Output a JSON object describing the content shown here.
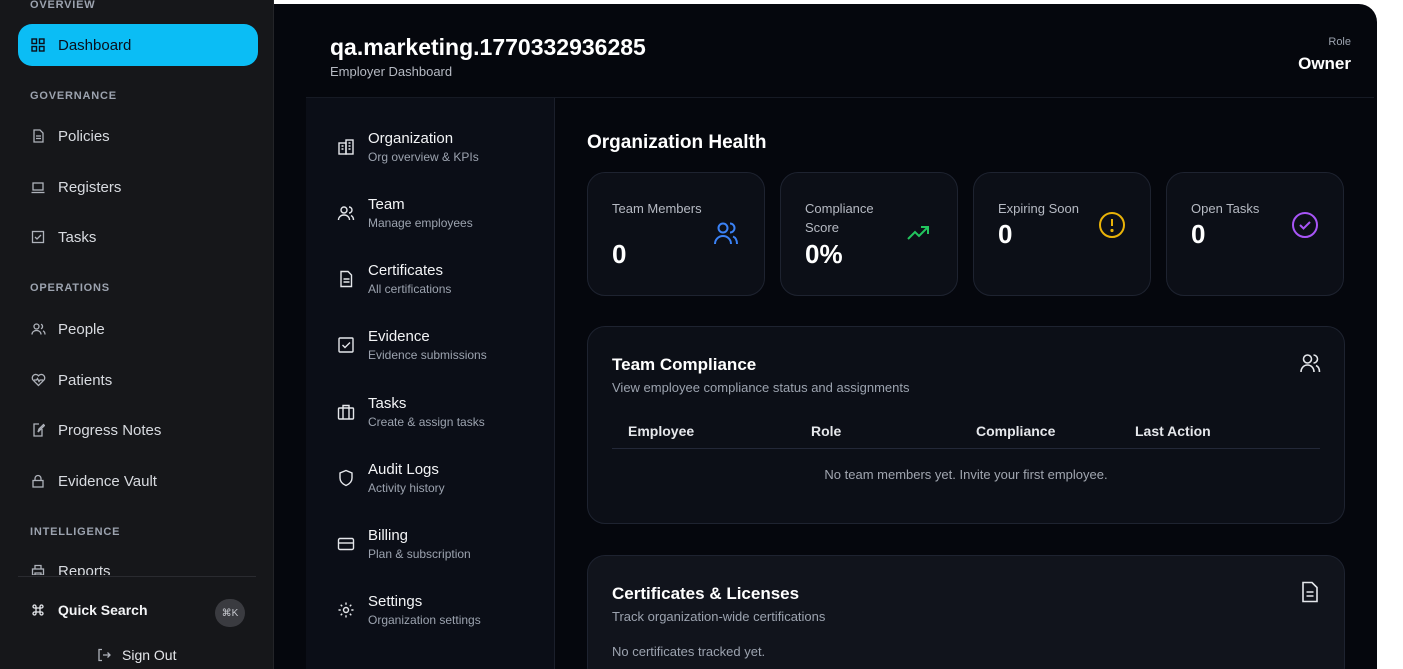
{
  "sidebar": {
    "overview_label": "OVERVIEW",
    "dashboard": "Dashboard",
    "governance_label": "GOVERNANCE",
    "policies": "Policies",
    "registers": "Registers",
    "tasks": "Tasks",
    "operations_label": "OPERATIONS",
    "people": "People",
    "patients": "Patients",
    "progress_notes": "Progress Notes",
    "evidence_vault": "Evidence Vault",
    "intelligence_label": "INTELLIGENCE",
    "reports": "Reports",
    "quick_search": "Quick Search",
    "quick_search_shortcut": "⌘K",
    "sign_out": "Sign Out"
  },
  "header": {
    "org_name": "qa.marketing.1770332936285",
    "subtitle": "Employer Dashboard",
    "role_label": "Role",
    "role_value": "Owner"
  },
  "inner_nav": [
    {
      "title": "Organization",
      "desc": "Org overview & KPIs",
      "icon": "building-icon"
    },
    {
      "title": "Team",
      "desc": "Manage employees",
      "icon": "users-icon"
    },
    {
      "title": "Certificates",
      "desc": "All certifications",
      "icon": "file-text-icon"
    },
    {
      "title": "Evidence",
      "desc": "Evidence submissions",
      "icon": "check-square-icon"
    },
    {
      "title": "Tasks",
      "desc": "Create & assign tasks",
      "icon": "briefcase-icon"
    },
    {
      "title": "Audit Logs",
      "desc": "Activity history",
      "icon": "shield-icon"
    },
    {
      "title": "Billing",
      "desc": "Plan & subscription",
      "icon": "credit-card-icon"
    },
    {
      "title": "Settings",
      "desc": "Organization settings",
      "icon": "gear-icon"
    }
  ],
  "health": {
    "title": "Organization Health",
    "kpis": [
      {
        "label": "Team Members",
        "value": "0",
        "icon": "users-icon",
        "color": "#3b82f6"
      },
      {
        "label": "Compliance Score",
        "value": "0%",
        "icon": "trending-up-icon",
        "color": "#22c55e"
      },
      {
        "label": "Expiring Soon",
        "value": "0",
        "icon": "alert-circle-icon",
        "color": "#eab308"
      },
      {
        "label": "Open Tasks",
        "value": "0",
        "icon": "check-circle-icon",
        "color": "#a855f7"
      }
    ]
  },
  "team_compliance": {
    "title": "Team Compliance",
    "desc": "View employee compliance status and assignments",
    "columns": [
      "Employee",
      "Role",
      "Compliance",
      "Last Action"
    ],
    "empty": "No team members yet. Invite your first employee."
  },
  "certificates": {
    "title": "Certificates & Licenses",
    "desc": "Track organization-wide certifications",
    "empty": "No certificates tracked yet."
  },
  "colors": {
    "accent": "#0bbdf5",
    "background": "#05070d",
    "sidebar": "#16171a"
  }
}
